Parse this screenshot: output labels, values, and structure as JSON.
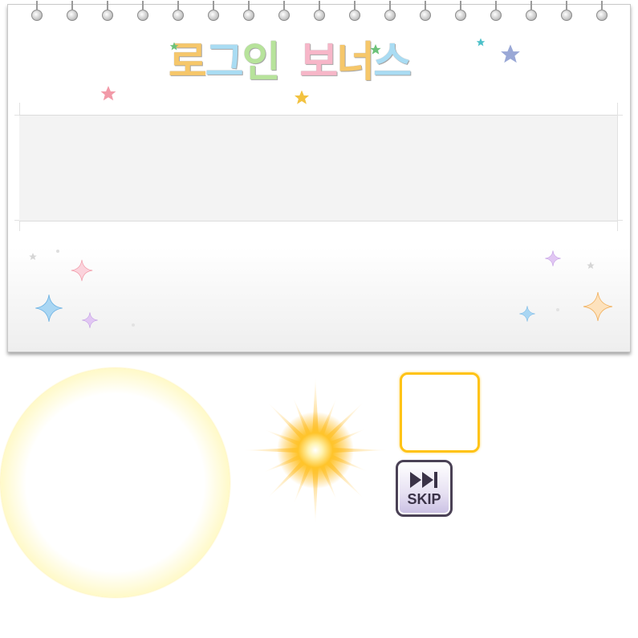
{
  "calendar": {
    "title_chars": [
      {
        "text": "로",
        "color": "#f6c76a"
      },
      {
        "text": "그",
        "color": "#a9dcf3"
      },
      {
        "text": "인",
        "color": "#b7e39b"
      },
      {
        "text": "보",
        "color": "#f7b6c8"
      },
      {
        "text": "너",
        "color": "#f6c76a"
      },
      {
        "text": "스",
        "color": "#a9dcf3"
      }
    ]
  },
  "skip_button": {
    "label": "SKIP",
    "icon": "fast-forward-skip-icon"
  },
  "colors": {
    "gold": "#ffc316",
    "star_pink": "#f29aa8",
    "star_green": "#6cc27a",
    "star_teal": "#4cc0c9",
    "star_blue": "#9aa8d6",
    "star_gold": "#f2c240"
  }
}
